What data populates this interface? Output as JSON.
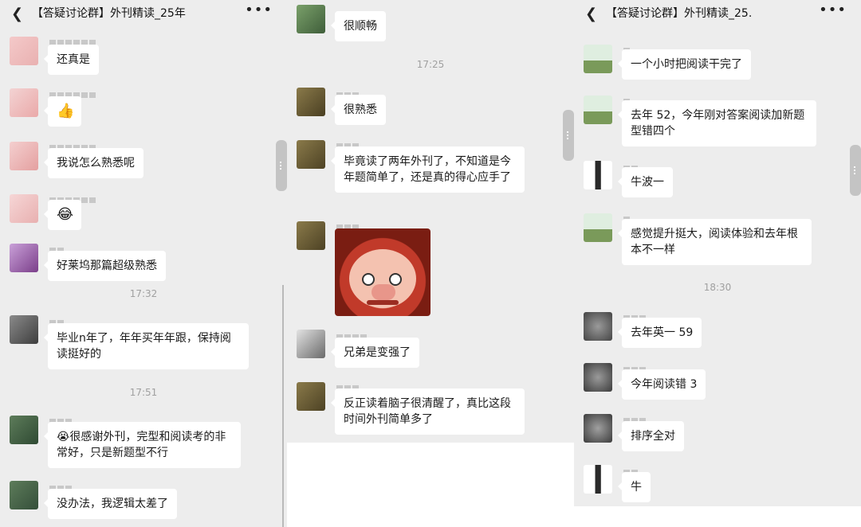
{
  "panels": [
    {
      "header": {
        "back_icon": "chevron-left-icon",
        "title": "【答疑讨论群】外刊精读_25年",
        "more_icon": "more-dots-icon"
      },
      "timestamps": [
        "17:32",
        "17:51"
      ],
      "messages": [
        {
          "text": "还真是"
        },
        {
          "emoji": "👍"
        },
        {
          "text": "我说怎么熟悉呢"
        },
        {
          "emoji": "😂"
        },
        {
          "text": "好莱坞那篇超级熟悉"
        },
        {
          "text": "毕业n年了，年年买年年跟，保持阅读挺好的"
        },
        {
          "text": "😭很感谢外刊，完型和阅读考的非常好，只是新题型不行"
        },
        {
          "text": "没办法，我逻辑太差了"
        }
      ]
    },
    {
      "timestamps": [
        "17:25"
      ],
      "messages": [
        {
          "text": "很顺畅"
        },
        {
          "text": "很熟悉"
        },
        {
          "text": "毕竟读了两年外刊了，不知道是今年题简单了，还是真的得心应手了"
        },
        {
          "sticker": "pig-sticker"
        },
        {
          "text": "兄弟是变强了"
        },
        {
          "text": "反正读着脑子很清醒了，真比这段时间外刊简单多了"
        }
      ]
    },
    {
      "header": {
        "back_icon": "chevron-left-icon",
        "title": "【答疑讨论群】外刊精读_25.",
        "more_icon": "more-dots-icon"
      },
      "timestamps": [
        "18:30"
      ],
      "messages": [
        {
          "text": "一个小时把阅读干完了"
        },
        {
          "text": "去年 52，今年刚对答案阅读加新题型错四个"
        },
        {
          "text": "牛波一"
        },
        {
          "text": "感觉提升挺大，阅读体验和去年根本不一样"
        },
        {
          "text": "去年英一 59"
        },
        {
          "text": "今年阅读错 3"
        },
        {
          "text": "排序全对"
        },
        {
          "text": "牛"
        }
      ]
    }
  ],
  "colors": {
    "background": "#ededed",
    "bubble": "#ffffff",
    "timestamp": "#a0a0a0"
  }
}
